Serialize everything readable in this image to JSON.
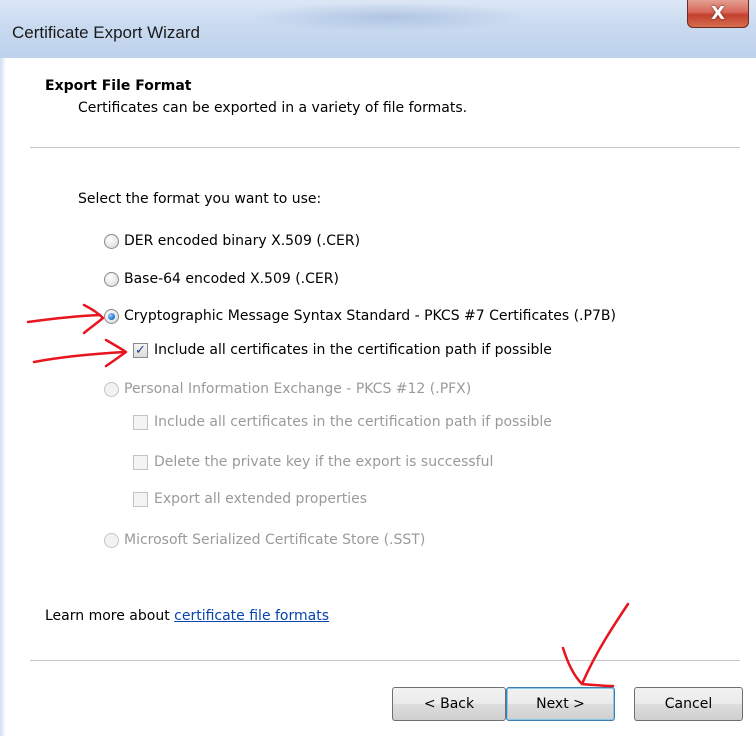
{
  "window": {
    "title": "Certificate Export Wizard",
    "close_label": "X"
  },
  "header": {
    "title": "Export File Format",
    "subtitle": "Certificates can be exported in a variety of file formats."
  },
  "form": {
    "prompt": "Select the format you want to use:",
    "options": [
      {
        "label": "DER encoded binary X.509 (.CER)",
        "type": "radio",
        "checked": false,
        "enabled": true
      },
      {
        "label": "Base-64 encoded X.509 (.CER)",
        "type": "radio",
        "checked": false,
        "enabled": true
      },
      {
        "label": "Cryptographic Message Syntax Standard - PKCS #7 Certificates (.P7B)",
        "type": "radio",
        "checked": true,
        "enabled": true
      },
      {
        "label": "Include all certificates in the certification path if possible",
        "type": "checkbox",
        "checked": true,
        "enabled": true
      },
      {
        "label": "Personal Information Exchange - PKCS #12 (.PFX)",
        "type": "radio",
        "checked": false,
        "enabled": false
      },
      {
        "label": "Include all certificates in the certification path if possible",
        "type": "checkbox",
        "checked": false,
        "enabled": false
      },
      {
        "label": "Delete the private key if the export is successful",
        "type": "checkbox",
        "checked": false,
        "enabled": false
      },
      {
        "label": "Export all extended properties",
        "type": "checkbox",
        "checked": false,
        "enabled": false
      },
      {
        "label": "Microsoft Serialized Certificate Store (.SST)",
        "type": "radio",
        "checked": false,
        "enabled": false
      }
    ]
  },
  "learn_more": {
    "prefix": "Learn more about ",
    "link": "certificate file formats"
  },
  "buttons": {
    "back": "< Back",
    "next": "Next >",
    "cancel": "Cancel"
  },
  "annotation_color": "#e8141e"
}
